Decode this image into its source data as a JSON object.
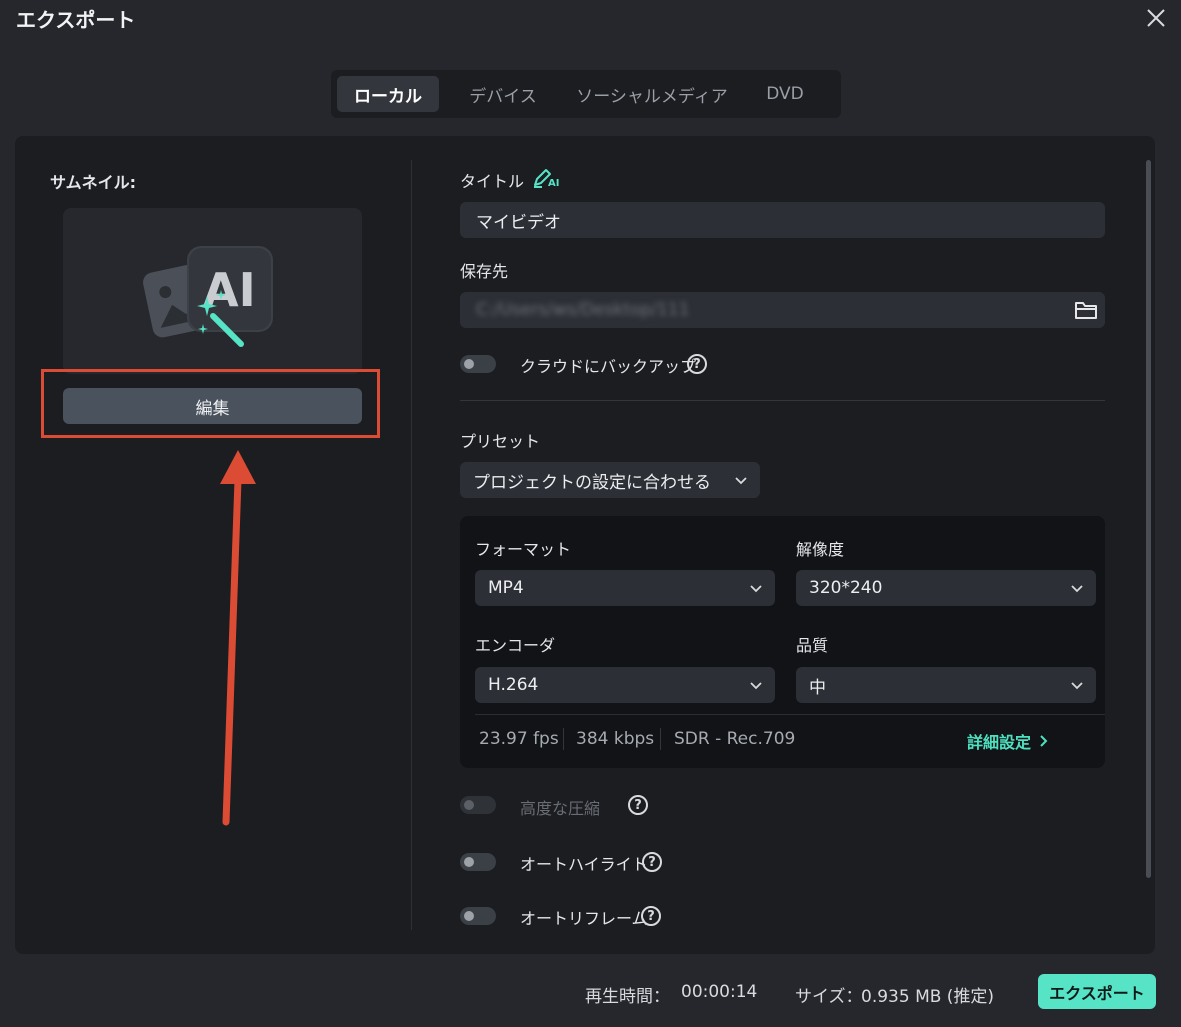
{
  "window": {
    "title": "エクスポート",
    "close_icon": "close-icon"
  },
  "tabs": [
    {
      "label": "ローカル",
      "active": true
    },
    {
      "label": "デバイス",
      "active": false
    },
    {
      "label": "ソーシャルメディア",
      "active": false
    },
    {
      "label": "DVD",
      "active": false
    }
  ],
  "thumbnail": {
    "label": "サムネイル:",
    "edit_label": "編集",
    "icon": "ai-image-magic-icon"
  },
  "title_field": {
    "label": "タイトル",
    "value": "マイビデオ",
    "ai_icon": "ai-pen-icon",
    "ai_badge": "AI"
  },
  "save_path": {
    "label": "保存先",
    "value": "C:/Users/ws/Desktop/111",
    "folder_icon": "folder-icon"
  },
  "cloud_backup": {
    "label": "クラウドにバックアップ",
    "enabled": false
  },
  "preset": {
    "label": "プリセット",
    "value": "プロジェクトの設定に合わせる"
  },
  "settings": {
    "format": {
      "label": "フォーマット",
      "value": "MP4"
    },
    "resolution": {
      "label": "解像度",
      "value": "320*240"
    },
    "encoder": {
      "label": "エンコーダ",
      "value": "H.264"
    },
    "quality": {
      "label": "品質",
      "value": "中"
    },
    "fps": "23.97 fps",
    "bitrate": "384 kbps",
    "color": "SDR - Rec.709",
    "advanced_label": "詳細設定"
  },
  "toggles": {
    "advanced_compression": {
      "label": "高度な圧縮",
      "enabled": false,
      "disabled": true
    },
    "auto_highlight": {
      "label": "オートハイライト",
      "enabled": false
    },
    "auto_reframe": {
      "label": "オートリフレーム",
      "enabled": false
    }
  },
  "footer": {
    "duration_label": "再生時間：",
    "duration_value": "00:00:14",
    "size_label": "サイズ：",
    "size_value": "0.935 MB (推定)",
    "export_label": "エクスポート"
  },
  "colors": {
    "accent": "#56e3c6",
    "highlight": "#dc4c34",
    "background": "#25272c",
    "panel": "#1b1d21"
  }
}
